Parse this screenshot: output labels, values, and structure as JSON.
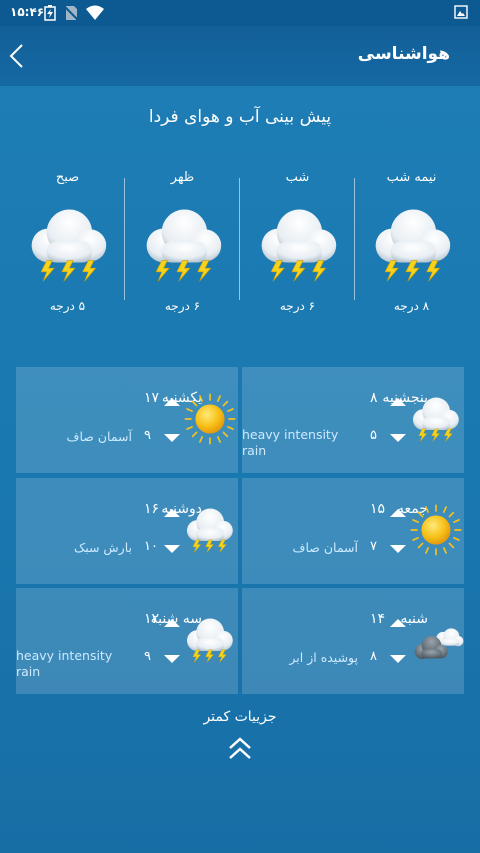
{
  "status_bar": {
    "time": "۱۵:۴۶"
  },
  "app_bar": {
    "title": "هواشناسی"
  },
  "forecast": {
    "title": "پیش بینی آب و هوای فردا",
    "periods": [
      {
        "name": "نیمه شب",
        "temp": "۸ درجه",
        "icon": "storm-icon"
      },
      {
        "name": "شب",
        "temp": "۶ درجه",
        "icon": "storm-icon"
      },
      {
        "name": "ظهر",
        "temp": "۶ درجه",
        "icon": "storm-icon"
      },
      {
        "name": "صبح",
        "temp": "۵ درجه",
        "icon": "storm-icon"
      }
    ]
  },
  "days": [
    {
      "day": "پنجشنبه",
      "high": "۸",
      "low": "۵",
      "condition": "heavy intensity rain",
      "icon": "storm-icon"
    },
    {
      "day": "یکشنبه",
      "high": "۱۷",
      "low": "۹",
      "condition": "آسمان صاف",
      "icon": "sun-icon"
    },
    {
      "day": "جمعه",
      "high": "۱۵",
      "low": "۷",
      "condition": "آسمان صاف",
      "icon": "sun-icon"
    },
    {
      "day": "دوشنبه",
      "high": "۱۶",
      "low": "۱۰",
      "condition": "بارش سبک",
      "icon": "storm-icon"
    },
    {
      "day": "شنبه",
      "high": "۱۴",
      "low": "۸",
      "condition": "پوشیده از ابر",
      "icon": "dark-clouds-icon"
    },
    {
      "day": "سه شنبه",
      "high": "۱۲",
      "low": "۹",
      "condition": "heavy intensity rain",
      "icon": "storm-icon"
    }
  ],
  "less_details": "جزییات کمتر",
  "colors": {
    "background": "#1b77ad",
    "app_bar": "#135f98",
    "bolt": "#f5d21c",
    "sun": "#f7c21a"
  }
}
